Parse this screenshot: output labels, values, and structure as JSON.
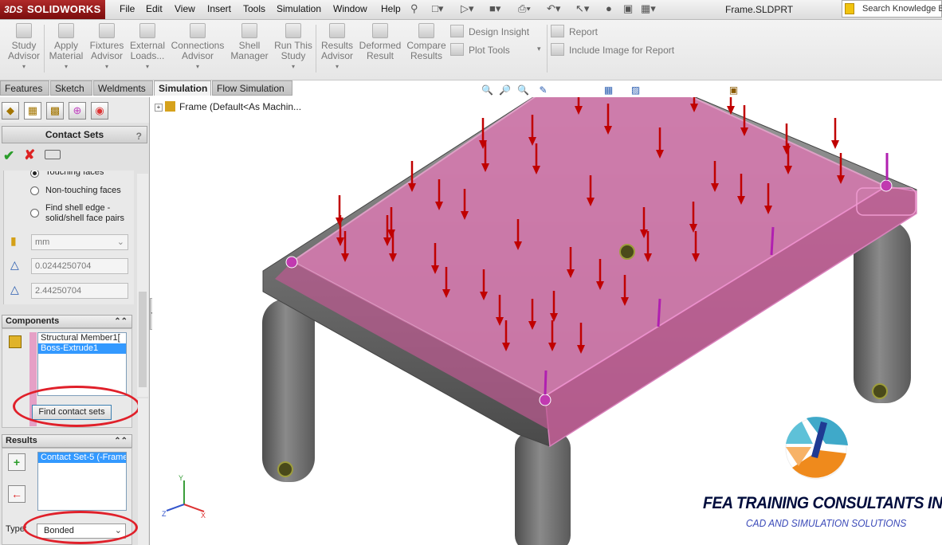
{
  "app": {
    "brand_prefix": "3DS",
    "brand": "SOLIDWORKS",
    "document_title": "Frame.SLDPRT"
  },
  "menu": [
    "File",
    "Edit",
    "View",
    "Insert",
    "Tools",
    "Simulation",
    "Window",
    "Help"
  ],
  "search": {
    "placeholder": "Search Knowledge B"
  },
  "command_manager": {
    "buttons": [
      {
        "label": "Study Advisor",
        "icon": "study-advisor-icon"
      },
      {
        "label": "Apply Material",
        "icon": "material-icon"
      },
      {
        "label": "Fixtures Advisor",
        "icon": "fixtures-icon"
      },
      {
        "label": "External Loads...",
        "icon": "loads-icon"
      },
      {
        "label": "Connections Advisor",
        "icon": "connections-icon"
      },
      {
        "label": "Shell Manager",
        "icon": "shell-icon"
      },
      {
        "label": "Run This Study",
        "icon": "run-icon"
      },
      {
        "label": "Results Advisor",
        "icon": "results-icon"
      },
      {
        "label": "Deformed Result",
        "icon": "deformed-icon"
      },
      {
        "label": "Compare Results",
        "icon": "compare-icon"
      }
    ],
    "design_insight": "Design Insight",
    "plot_tools": "Plot Tools",
    "report": "Report",
    "include_image": "Include Image for Report"
  },
  "tabs": [
    {
      "label": "Features",
      "active": false
    },
    {
      "label": "Sketch",
      "active": false
    },
    {
      "label": "Weldments",
      "active": false
    },
    {
      "label": "Simulation",
      "active": true
    },
    {
      "label": "Flow Simulation",
      "active": false
    }
  ],
  "property_manager": {
    "title": "Contact Sets",
    "help": "?",
    "options": {
      "touching": "Touching faces",
      "non_touching": "Non-touching faces",
      "find_shell_edge": "Find shell edge - solid/shell face pairs"
    },
    "units": "mm",
    "tolerance_1": "0.0244250704",
    "tolerance_2": "2.44250704",
    "components": {
      "header": "Components",
      "items": [
        "Structural Member1[",
        "Boss-Extrude1"
      ],
      "find_button": "Find contact sets"
    },
    "results": {
      "header": "Results",
      "items": [
        "Contact Set-5 (-Frame"
      ],
      "type_label": "Type:",
      "type_value": "Bonded"
    }
  },
  "feature_tree": {
    "node": "Frame  (Default<As Machin..."
  },
  "watermark": {
    "company": "FEA TRAINING  CONSULTANTS INC.",
    "tagline": "CAD AND SIMULATION SOLUTIONS"
  },
  "colors": {
    "selection_pink": "#d36aa8",
    "load_arrow": "#cc0000",
    "frame_gray": "#6e6e6e",
    "accent": "#3399ff"
  }
}
